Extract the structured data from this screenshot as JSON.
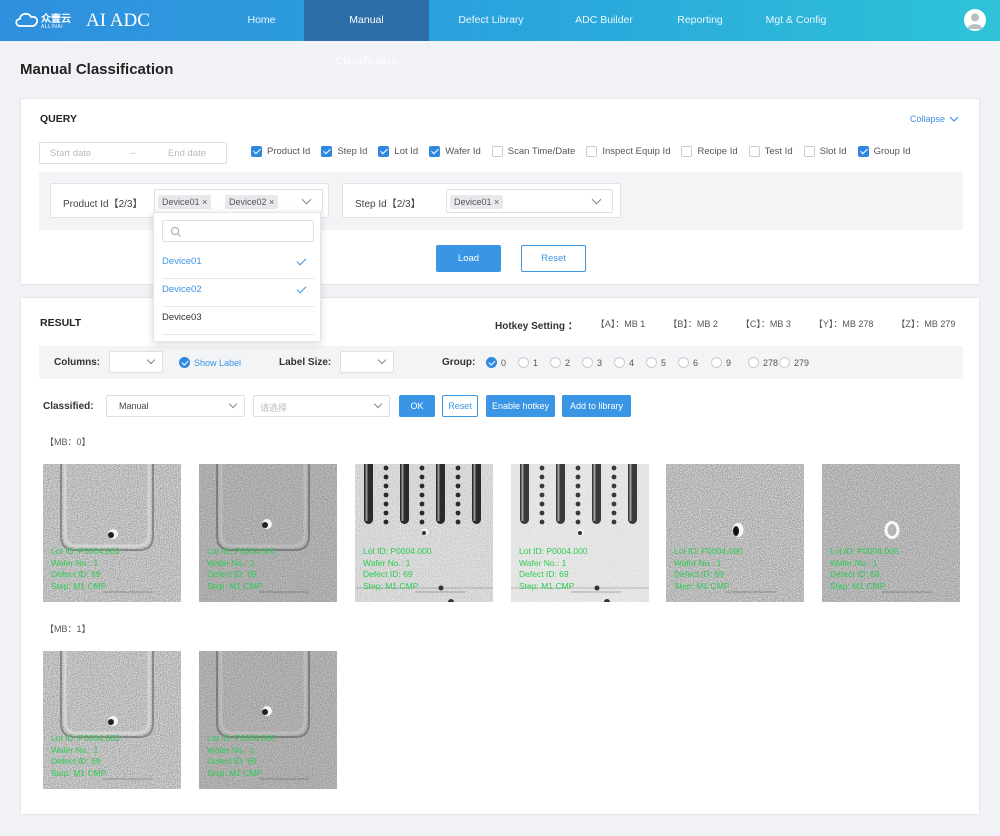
{
  "header": {
    "logo_cn": "众壹云",
    "logo_en": "ALLINAI",
    "app_title": "AI ADC",
    "nav": [
      {
        "label": "Home"
      },
      {
        "label": "Manual Classification"
      },
      {
        "label": "Defect Library"
      },
      {
        "label": "ADC Builder"
      },
      {
        "label": "Reporting"
      },
      {
        "label": "Mgt & Config"
      }
    ],
    "active_nav": "Manual Classification"
  },
  "page_title": "Manual Classification",
  "query": {
    "title": "QUERY",
    "collapse_label": "Collapse",
    "date_start_placeholder": "Start date",
    "date_sep": "--",
    "date_end_placeholder": "End date",
    "columns": [
      {
        "label": "Product Id",
        "checked": true
      },
      {
        "label": "Step Id",
        "checked": true
      },
      {
        "label": "Lot Id",
        "checked": true
      },
      {
        "label": "Wafer Id",
        "checked": true
      },
      {
        "label": "Scan Time/Date",
        "checked": false
      },
      {
        "label": "Inspect Equip Id",
        "checked": false
      },
      {
        "label": "Recipe Id",
        "checked": false
      },
      {
        "label": "Test Id",
        "checked": false
      },
      {
        "label": "Slot Id",
        "checked": false
      },
      {
        "label": "Group Id",
        "checked": true
      }
    ],
    "product_filter": {
      "label": "Product Id【2/3】",
      "tags": [
        "Device01",
        "Device02"
      ]
    },
    "step_filter": {
      "label": "Step Id【2/3】",
      "tags": [
        "Device01"
      ]
    },
    "dropdown": {
      "options": [
        {
          "label": "Device01",
          "selected": true
        },
        {
          "label": "Device02",
          "selected": true
        },
        {
          "label": "Device03",
          "selected": false
        }
      ]
    },
    "load_label": "Load",
    "reset_label": "Reset"
  },
  "result": {
    "title": "RESULT",
    "hotkey_title": "Hotkey Setting ：",
    "hotkeys": [
      "【A】：MB 1",
      "【B】：MB 2",
      "【C】：MB 3",
      "【Y】：MB 278",
      "【Z】：MB 279"
    ],
    "columns_label": "Columns:",
    "show_label": "Show Label",
    "label_size_label": "Label Size:",
    "group_label": "Group:",
    "groups": [
      {
        "label": "0",
        "selected": true
      },
      {
        "label": "1",
        "selected": false
      },
      {
        "label": "2",
        "selected": false
      },
      {
        "label": "3",
        "selected": false
      },
      {
        "label": "4",
        "selected": false
      },
      {
        "label": "5",
        "selected": false
      },
      {
        "label": "6",
        "selected": false
      },
      {
        "label": "9",
        "selected": false
      },
      {
        "label": "278",
        "selected": false
      },
      {
        "label": "279",
        "selected": false
      }
    ],
    "classified_label": "Classified:",
    "classified_value": "Manual",
    "second_select_placeholder": "请选择",
    "ok_label": "OK",
    "reset_label": "Reset",
    "enable_hotkey_label": "Enable hotkey",
    "add_library_label": "Add to library",
    "bins": [
      {
        "label": "【MB：0】",
        "images": [
          {
            "style": "pad",
            "lines": [
              "Lot ID: P0004.000",
              "Wafer No.: 1",
              "Defect ID: 69",
              "Step: M1 CMP"
            ]
          },
          {
            "style": "pad-dim",
            "lines": [
              "Lot ID: P0004.000",
              "Wafer No.: 1",
              "Defect ID: 69",
              "Step: M1 CMP"
            ]
          },
          {
            "style": "slots",
            "lines": [
              "Lot ID: P0004.000",
              "Wafer No.: 1",
              "Defect ID: 69",
              "Step: M1 CMP"
            ]
          },
          {
            "style": "slots-clear",
            "lines": [
              "Lot ID: P0004.000",
              "Wafer No.: 1",
              "Defect ID: 69",
              "Step: M1 CMP"
            ]
          },
          {
            "style": "noise",
            "lines": [
              "Lot ID: P0004.000",
              "Wafer No.: 1",
              "Defect ID: 69",
              "Step: M1 CMP"
            ]
          },
          {
            "style": "noise-ring",
            "lines": [
              "Lot ID: P0004.000",
              "Wafer No.: 1",
              "Defect ID: 69",
              "Step: M1 CMP"
            ]
          }
        ]
      },
      {
        "label": "【MB：1】",
        "images": [
          {
            "style": "pad",
            "lines": [
              "Lot ID: P0004.000",
              "Wafer No.: 1",
              "Defect ID: 69",
              "Step: M1 CMP"
            ]
          },
          {
            "style": "pad-dim",
            "lines": [
              "Lot ID: P0004.000",
              "Wafer No.: 1",
              "Defect ID: 69",
              "Step: M1 CMP"
            ]
          }
        ]
      }
    ]
  },
  "colors": {
    "primary": "#3a95e4",
    "nav_active": "#2d6ea8",
    "label_text": "#2ecc52"
  }
}
